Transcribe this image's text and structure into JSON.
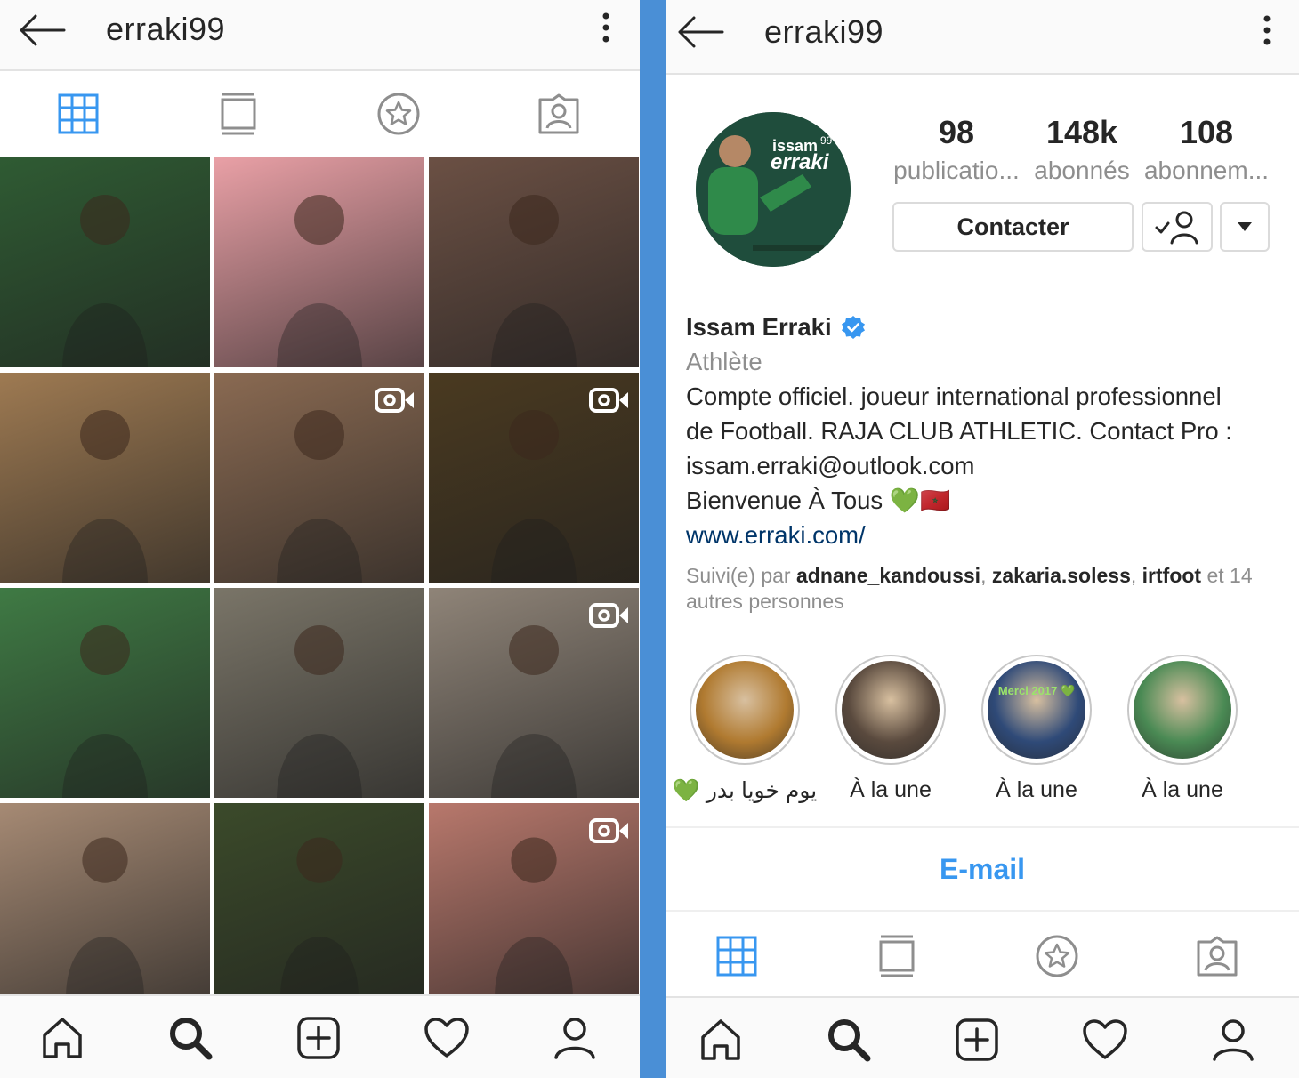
{
  "left": {
    "username": "erraki99",
    "tabs": [
      "grid-icon",
      "feed-icon",
      "star-icon",
      "tagged-icon"
    ],
    "posts": [
      {
        "bg": "#2f5b33",
        "video": false
      },
      {
        "bg": "#e9a0a6",
        "video": false
      },
      {
        "bg": "#6b5044",
        "video": false
      },
      {
        "bg": "#9e7a52",
        "video": false
      },
      {
        "bg": "#8a6a52",
        "video": true
      },
      {
        "bg": "#4a3a20",
        "video": true
      },
      {
        "bg": "#3f7a44",
        "video": false
      },
      {
        "bg": "#7a7568",
        "video": false
      },
      {
        "bg": "#8f8478",
        "video": true
      },
      {
        "bg": "#a68a74",
        "video": false
      },
      {
        "bg": "#3b4a2a",
        "video": false
      },
      {
        "bg": "#b8786c",
        "video": true
      }
    ]
  },
  "right": {
    "username": "erraki99",
    "avatar_text": [
      "issam",
      "erraki"
    ],
    "avatar_number": "99",
    "stats": [
      {
        "num": "98",
        "label": "publicatio..."
      },
      {
        "num": "148k",
        "label": "abonnés"
      },
      {
        "num": "108",
        "label": "abonnem..."
      }
    ],
    "contact_label": "Contacter",
    "name": "Issam Erraki",
    "category": "Athlète",
    "bio_lines": [
      "Compte officiel. joueur international professionnel",
      "de Football. RAJA CLUB ATHLETIC. Contact Pro :",
      "issam.erraki@outlook.com",
      "Bienvenue À Tous 💚🇲🇦"
    ],
    "website": "www.erraki.com/",
    "followed_by_prefix": "Suivi(e) par",
    "followed_by": [
      "adnane_kandoussi",
      "zakaria.soless",
      "irtfoot"
    ],
    "followed_by_suffix": "et 14",
    "followed_by_suffix2": "autres personnes",
    "highlights": [
      {
        "label": "💚 يوم خويا بدر",
        "bg": "#b07a30"
      },
      {
        "label": "À la une",
        "bg": "#5a4a3e"
      },
      {
        "label": "À la une",
        "bg": "#2f4a78",
        "overlay": "Merci 2017 💚"
      },
      {
        "label": "À la une",
        "bg": "#4a8a54"
      }
    ],
    "email_label": "E-mail"
  },
  "colors": {
    "accent": "#3897f0",
    "verified": "#3897f0",
    "link": "#003569",
    "muted": "#8e8e8e",
    "divider_bg": "#4a8fd6"
  }
}
